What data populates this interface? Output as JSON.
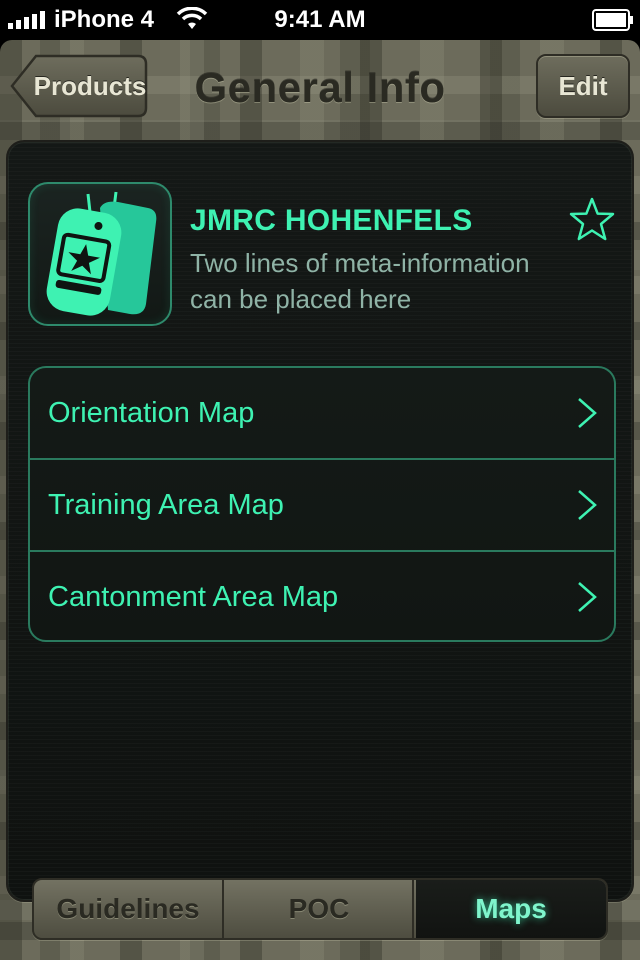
{
  "status_bar": {
    "carrier": "iPhone 4",
    "time": "9:41 AM"
  },
  "nav": {
    "back_label": "Products",
    "title": "General Info",
    "edit_label": "Edit"
  },
  "item": {
    "icon": "dog-tags-icon",
    "title": "JMRC HOHENFELS",
    "meta_line1": "Two lines of meta-information",
    "meta_line2": "can be placed here",
    "favorite_icon": "star-outline-icon"
  },
  "maps_list": [
    {
      "label": "Orientation Map"
    },
    {
      "label": "Training Area Map"
    },
    {
      "label": "Cantonment Area Map"
    }
  ],
  "tabs": [
    {
      "label": "Guidelines",
      "selected": false
    },
    {
      "label": "POC",
      "selected": false
    },
    {
      "label": "Maps",
      "selected": true
    }
  ],
  "colors": {
    "accent_green": "#3ef2b2",
    "panel_dark": "#121613",
    "camo_base": "#6c6b5b"
  }
}
